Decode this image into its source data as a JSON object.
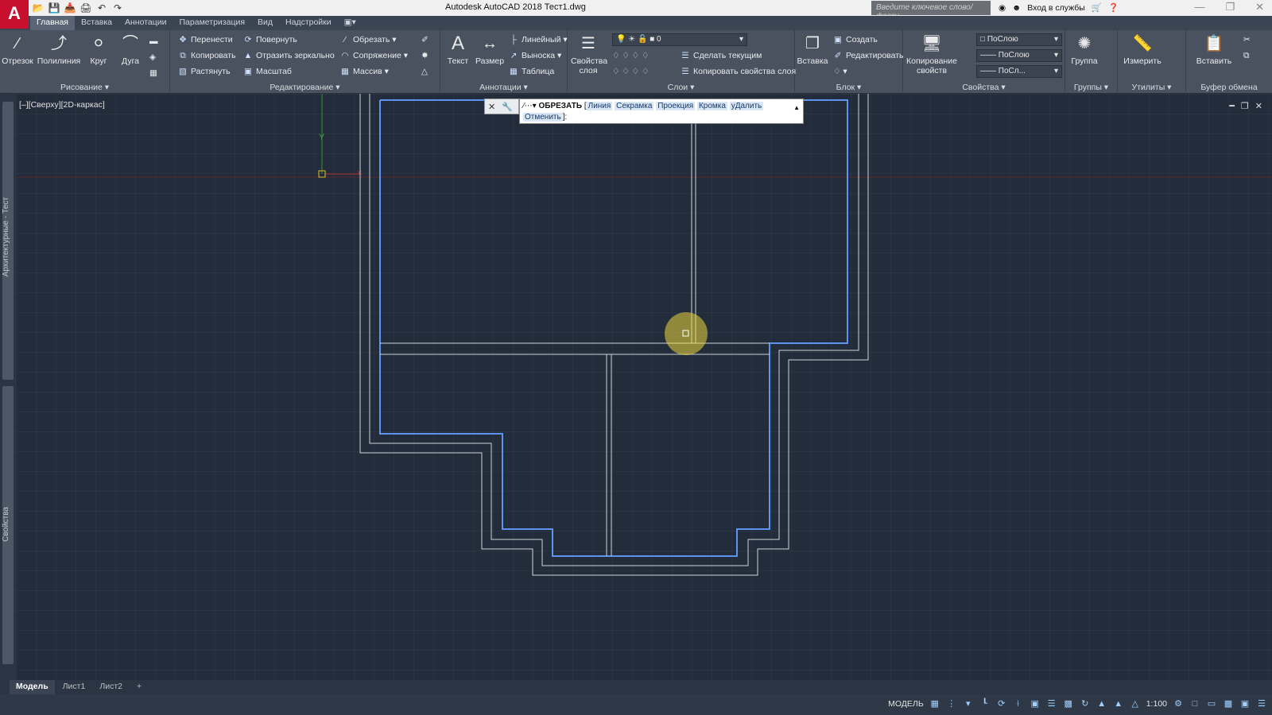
{
  "app": {
    "logo_letter": "A",
    "title": "Autodesk AutoCAD 2018   Тест1.dwg"
  },
  "quick_access": [
    "open-icon",
    "save-icon",
    "saveas-icon",
    "print-icon",
    "undo-icon",
    "redo-icon"
  ],
  "search": {
    "placeholder": "Введите ключевое слово/фразу"
  },
  "signin": {
    "label": "Вход в службы"
  },
  "ribbon_tabs": [
    {
      "label": "Главная",
      "active": true
    },
    {
      "label": "Вставка"
    },
    {
      "label": "Аннотации"
    },
    {
      "label": "Параметризация"
    },
    {
      "label": "Вид"
    },
    {
      "label": "Надстройки"
    }
  ],
  "panels": {
    "draw": {
      "title": "Рисование",
      "line": "Отрезок",
      "polyline": "Полилиния",
      "circle": "Круг",
      "arc": "Дуга"
    },
    "modify": {
      "title": "Редактирование",
      "move": "Перенести",
      "rotate": "Повернуть",
      "trim": "Обрезать",
      "copy": "Копировать",
      "mirror": "Отразить зеркально",
      "fillet": "Сопряжение",
      "stretch": "Растянуть",
      "scale": "Масштаб",
      "array": "Массив"
    },
    "annotation": {
      "title": "Аннотации",
      "text": "Текст",
      "dimension": "Размер",
      "linear": "Линейный",
      "leader": "Выноска",
      "table": "Таблица"
    },
    "layers": {
      "title": "Слои",
      "props": "Свойства слоя",
      "layer_value": "0",
      "make_current": "Сделать текущим",
      "match_layer": "Копировать свойства слоя"
    },
    "block": {
      "title": "Блок",
      "insert": "Вставка",
      "create": "Создать",
      "edit": "Редактировать"
    },
    "properties": {
      "title": "Свойства",
      "match": "Копирование свойств",
      "color": "ПоСлою",
      "linetype": "ПоСлою",
      "lineweight": "ПоСл..."
    },
    "groups": {
      "title": "Группы",
      "group": "Группа"
    },
    "utilities": {
      "title": "Утилиты",
      "measure": "Измерить"
    },
    "clipboard": {
      "title": "Буфер обмена",
      "paste": "Вставить"
    }
  },
  "viewport": {
    "label": "[–][Сверху][2D-каркас]",
    "y_axis": "Y"
  },
  "palettes": {
    "top": "Архитектурные - Тест",
    "bottom": "Свойства"
  },
  "command": {
    "name": "ОБРЕЗАТЬ",
    "open": "[",
    "options": [
      "Линия",
      "Секрамка",
      "Проекция",
      "Кромка",
      "уДалить",
      "Отменить"
    ],
    "close": "]:"
  },
  "layout_tabs": [
    {
      "label": "Модель",
      "active": true
    },
    {
      "label": "Лист1"
    },
    {
      "label": "Лист2"
    },
    {
      "label": "+"
    }
  ],
  "status": {
    "mode": "МОДЕЛЬ",
    "scale": "1:100"
  }
}
